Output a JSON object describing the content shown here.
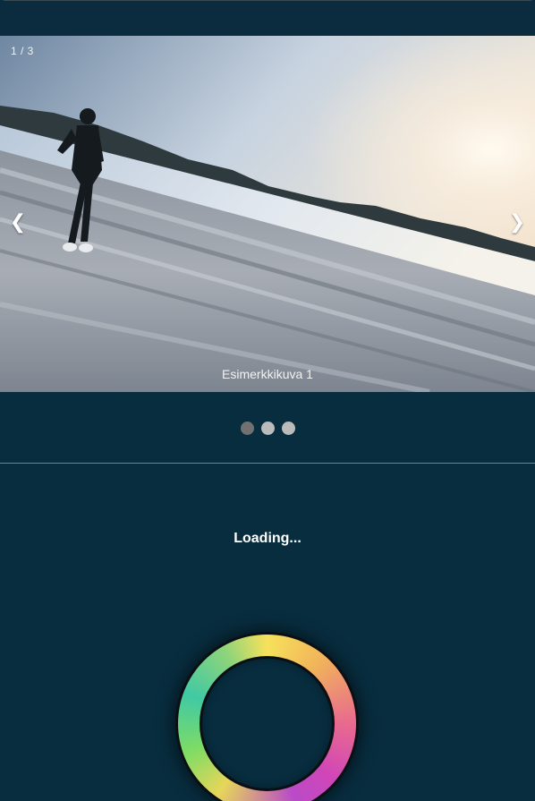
{
  "slideshow": {
    "counter": "1 / 3",
    "prev_label": "❮",
    "next_label": "❯",
    "caption": "Esimerkkikuva 1",
    "total_slides": 3,
    "active_slide": 1
  },
  "loading": {
    "text": "Loading..."
  },
  "colors": {
    "background": "#082d3f",
    "dot_active": "#717171",
    "dot_inactive": "#bbbbbb"
  }
}
